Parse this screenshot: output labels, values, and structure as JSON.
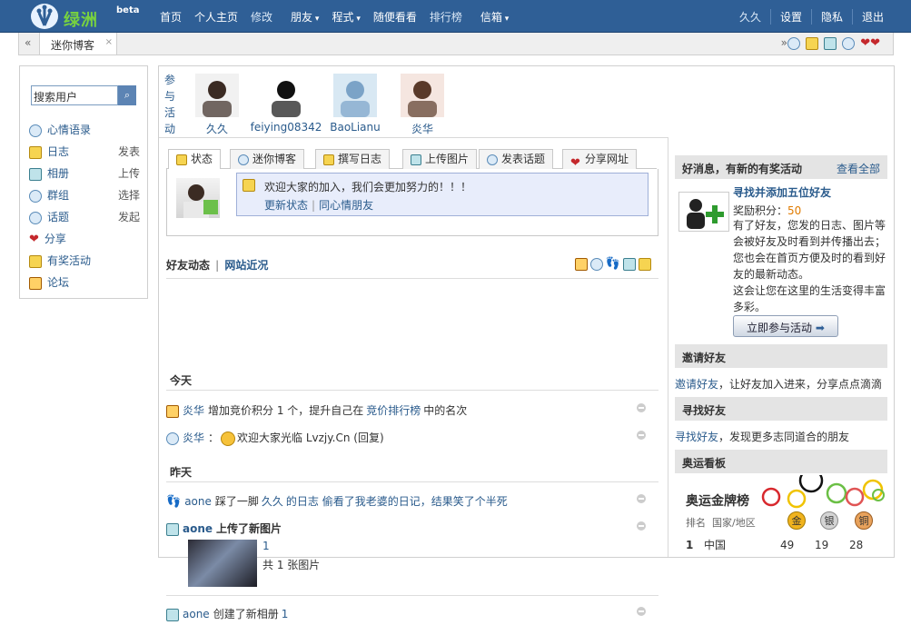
{
  "header": {
    "logo_text": "绿洲",
    "beta": "beta",
    "nav": [
      {
        "label": "首页",
        "sub": false,
        "dropdown": false
      },
      {
        "label": "个人主页",
        "sub": false,
        "dropdown": false
      },
      {
        "label": "修改",
        "sub": true,
        "dropdown": false
      },
      {
        "label": "朋友",
        "sub": false,
        "dropdown": true
      },
      {
        "label": "程式",
        "sub": false,
        "dropdown": true
      },
      {
        "label": "随便看看",
        "sub": false,
        "dropdown": false
      },
      {
        "label": "排行榜",
        "sub": true,
        "dropdown": false
      },
      {
        "label": "信箱",
        "sub": false,
        "dropdown": true
      }
    ],
    "right": [
      "久久",
      "设置",
      "隐私",
      "退出"
    ]
  },
  "tabbar": {
    "left_arrow": "«",
    "right_arrow": "»",
    "tab_label": "迷你博客",
    "close": "×"
  },
  "sidebar": {
    "search_value": "搜索用户",
    "search_icon": "search-icon",
    "items": [
      {
        "icon": "mood-icon",
        "label": "心情语录",
        "action": ""
      },
      {
        "icon": "blog-icon",
        "label": "日志",
        "action": "发表"
      },
      {
        "icon": "album-icon",
        "label": "相册",
        "action": "上传"
      },
      {
        "icon": "group-icon",
        "label": "群组",
        "action": "选择"
      },
      {
        "icon": "topic-icon",
        "label": "话题",
        "action": "发起"
      },
      {
        "icon": "heart-icon",
        "label": "分享",
        "action": ""
      },
      {
        "icon": "activity-icon",
        "label": "有奖活动",
        "action": ""
      },
      {
        "icon": "forum-icon",
        "label": "论坛",
        "action": ""
      }
    ]
  },
  "participants": {
    "label": "参与活动",
    "users": [
      "久久",
      "feiying08342",
      "BaoLianu",
      "炎华"
    ]
  },
  "composer": {
    "tabs": [
      "状态",
      "迷你博客",
      "撰写日志",
      "上传图片",
      "发表话题",
      "分享网址"
    ],
    "welcome": "欢迎大家的加入，我们会更加努力的！！！",
    "update_link": "更新状态",
    "same_mood_link": "同心情朋友"
  },
  "feed": {
    "tab_active": "好友动态",
    "tab_other": "网站近况",
    "today": "今天",
    "yesterday": "昨天",
    "items": [
      {
        "icon": "vip-icon",
        "user": "炎华",
        "text": "增加竞价积分 1 个，提升自己在",
        "link": "竞价排行榜",
        "tail": "中的名次"
      },
      {
        "icon": "mood-icon",
        "user": "炎华",
        "text": "：",
        "emoji": "sunglasses-emoji",
        "link": "",
        "tail": "欢迎大家光临 Lvzjy.Cn (回复)"
      },
      {
        "icon": "footprint-icon",
        "user": "aone",
        "text": "踩了一脚",
        "link": "久久",
        "tail": "的日志 偷看了我老婆的日记，结果笑了个半死"
      },
      {
        "icon": "photo-icon",
        "user": "aone",
        "text": "上传了新图片",
        "link": "",
        "tail": ""
      },
      {
        "icon": "album-icon",
        "user": "aone",
        "text": "创建了新相册",
        "link": "1",
        "tail": ""
      }
    ],
    "photo": {
      "title": "1",
      "count": "共 1 张图片"
    }
  },
  "right": {
    "news_title": "好消息，有新的有奖活动",
    "view_all": "查看全部",
    "promo_title": "寻找并添加五位好友",
    "reward_label": "奖励积分：",
    "reward_value": "50",
    "promo_desc": [
      "有了好友，您发的日志、图片等",
      "会被好友及时看到并传播出去；",
      "您也会在首页方便及时的看到好",
      "友的最新动态。",
      "这会让您在这里的生活变得丰富",
      "多彩。"
    ],
    "join_button": "立即参与活动",
    "invite_title": "邀请好友",
    "invite_link": "邀请好友",
    "invite_text": "，让好友加入进来，分享点点滴滴",
    "find_title": "寻找好友",
    "find_link": "寻找好友",
    "find_text": "，发现更多志同道合的朋友",
    "olympic_title": "奥运看板",
    "olympic_sub": "奥运金牌榜",
    "col_rank": "排名",
    "col_country": "国家/地区",
    "medals": [
      "金",
      "银",
      "铜"
    ],
    "rows": [
      {
        "rank": "1",
        "country": "中国",
        "gold": "49",
        "silver": "19",
        "bronze": "28"
      }
    ]
  }
}
